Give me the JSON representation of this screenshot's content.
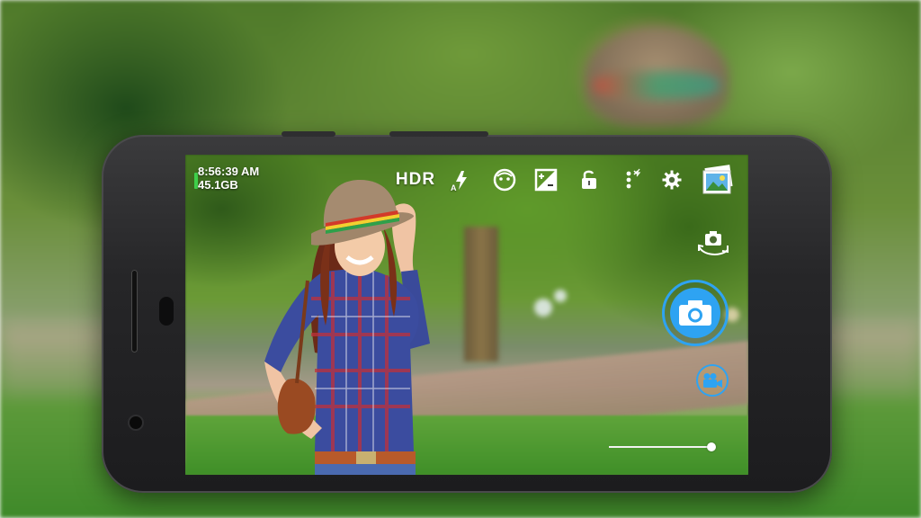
{
  "status": {
    "time": "8:56:39 AM",
    "storage": "45.1GB"
  },
  "toolbar": {
    "hdr_label": "HDR",
    "icons": [
      "flash-auto-icon",
      "face-detect-icon",
      "exposure-icon",
      "lock-icon",
      "more-options-icon",
      "settings-icon",
      "gallery-icon"
    ]
  },
  "controls": {
    "switch_camera_icon": "switch-camera-icon",
    "shutter_icon": "camera-icon",
    "video_icon": "video-camera-icon",
    "zoom_level": 0.98
  },
  "colors": {
    "accent": "#2ea3f2",
    "battery": "#3ecf4a"
  }
}
